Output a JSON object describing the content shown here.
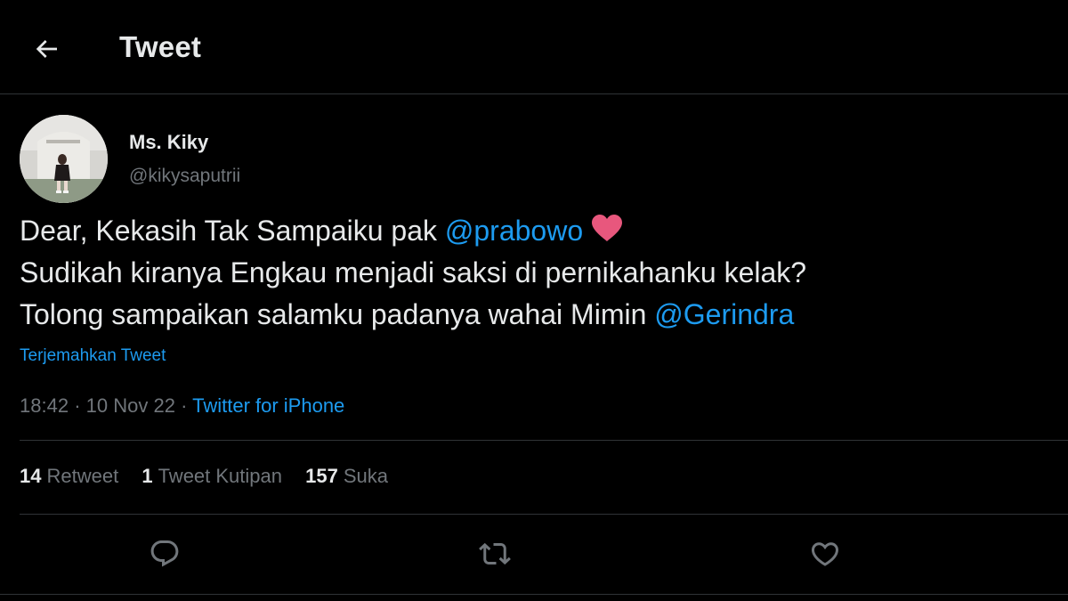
{
  "header": {
    "title": "Tweet",
    "back_icon": "arrow-left-icon"
  },
  "tweet": {
    "author": {
      "display_name": "Ms. Kiky",
      "handle": "@kikysaputrii",
      "avatar_icon": "profile-photo"
    },
    "lines": [
      {
        "before": "Dear, Kekasih Tak Sampaiku pak ",
        "mention": "@prabowo",
        "emoji": "heart-emoji"
      },
      {
        "before": "Sudikah kiranya Engkau menjadi saksi di pernikahanku kelak?"
      },
      {
        "before": "Tolong sampaikan salamku padanya wahai Mimin ",
        "mention": "@Gerindra"
      }
    ],
    "translate_label": "Terjemahkan Tweet",
    "time": "18:42",
    "separator": "·",
    "date": "10 Nov 22",
    "source": "Twitter for iPhone"
  },
  "stats": [
    {
      "count": "14",
      "label": "Retweet"
    },
    {
      "count": "1",
      "label": "Tweet Kutipan"
    },
    {
      "count": "157",
      "label": "Suka"
    }
  ],
  "actions": [
    "reply-icon",
    "retweet-icon",
    "like-icon"
  ],
  "colors": {
    "background": "#000000",
    "text": "#e7e9ea",
    "secondary": "#71767b",
    "link": "#1d9bf0",
    "divider": "#2f3336",
    "heart": "#e8577d"
  }
}
